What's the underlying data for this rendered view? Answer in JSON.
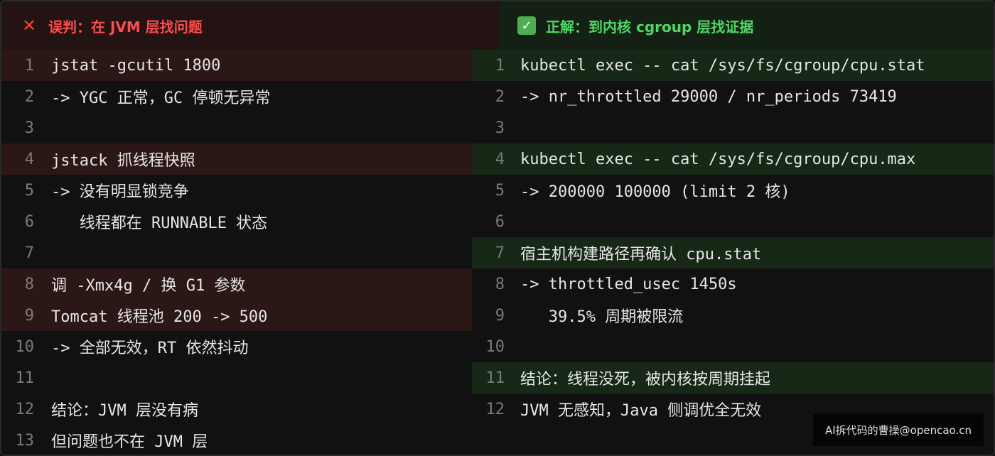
{
  "left": {
    "header_icon": "cross-mark-icon",
    "header_label": "误判：在 JVM 层找问题",
    "lines": [
      {
        "num": "1",
        "text": "jstat -gcutil 1800",
        "highlight": true
      },
      {
        "num": "2",
        "text": "-> YGC 正常，GC 停顿无异常",
        "highlight": false
      },
      {
        "num": "3",
        "text": "",
        "highlight": false
      },
      {
        "num": "4",
        "text": "jstack 抓线程快照",
        "highlight": true
      },
      {
        "num": "5",
        "text": "-> 没有明显锁竞争",
        "highlight": false
      },
      {
        "num": "6",
        "text": "   线程都在 RUNNABLE 状态",
        "highlight": false
      },
      {
        "num": "7",
        "text": "",
        "highlight": false
      },
      {
        "num": "8",
        "text": "调 -Xmx4g / 换 G1 参数",
        "highlight": true
      },
      {
        "num": "9",
        "text": "Tomcat 线程池 200 -> 500",
        "highlight": true
      },
      {
        "num": "10",
        "text": "-> 全部无效，RT 依然抖动",
        "highlight": false
      },
      {
        "num": "11",
        "text": "",
        "highlight": false
      },
      {
        "num": "12",
        "text": "结论：JVM 层没有病",
        "highlight": false
      },
      {
        "num": "13",
        "text": "但问题也不在 JVM 层",
        "highlight": false
      }
    ]
  },
  "right": {
    "header_icon": "check-mark-icon",
    "header_label": "正解：到内核 cgroup 层找证据",
    "lines": [
      {
        "num": "1",
        "text": "kubectl exec -- cat /sys/fs/cgroup/cpu.stat",
        "highlight": true
      },
      {
        "num": "2",
        "text": "-> nr_throttled 29000 / nr_periods 73419",
        "highlight": false
      },
      {
        "num": "3",
        "text": "",
        "highlight": false
      },
      {
        "num": "4",
        "text": "kubectl exec -- cat /sys/fs/cgroup/cpu.max",
        "highlight": true
      },
      {
        "num": "5",
        "text": "-> 200000 100000 (limit 2 核)",
        "highlight": false
      },
      {
        "num": "6",
        "text": "",
        "highlight": false
      },
      {
        "num": "7",
        "text": "宿主机构建路径再确认 cpu.stat",
        "highlight": true
      },
      {
        "num": "8",
        "text": "-> throttled_usec 1450s",
        "highlight": false
      },
      {
        "num": "9",
        "text": "   39.5% 周期被限流",
        "highlight": false
      },
      {
        "num": "10",
        "text": "",
        "highlight": false
      },
      {
        "num": "11",
        "text": "结论：线程没死，被内核按周期挂起",
        "highlight": true
      },
      {
        "num": "12",
        "text": "JVM 无感知，Java 侧调优全无效",
        "highlight": false
      }
    ]
  },
  "watermark": "AI拆代码的曹操@opencao.cn",
  "colors": {
    "wrong_accent": "#ff4b4b",
    "right_accent": "#4cd864",
    "wrong_highlight": "#2c1717",
    "right_highlight": "#172817"
  }
}
